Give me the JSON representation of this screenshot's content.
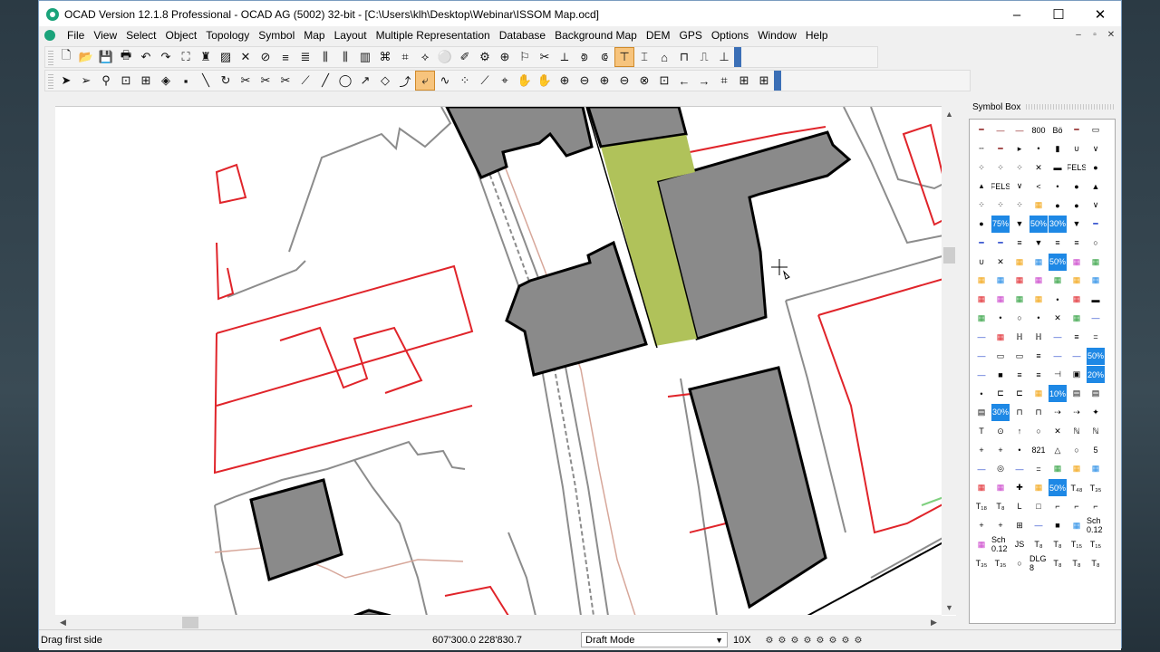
{
  "window": {
    "title": "OCAD Version 12.1.8  Professional - OCAD AG (5002) 32-bit - [C:\\Users\\klh\\Desktop\\Webinar\\ISSOM Map.ocd]",
    "minimize": "–",
    "maximize": "☐",
    "close": "✕"
  },
  "menu": [
    "File",
    "View",
    "Select",
    "Object",
    "Topology",
    "Symbol",
    "Map",
    "Layout",
    "Multiple Representation",
    "Database",
    "Background Map",
    "DEM",
    "GPS",
    "Options",
    "Window",
    "Help"
  ],
  "mdi": [
    "–",
    "▫",
    "✕"
  ],
  "toolbar1": [
    "🗋",
    "📂",
    "💾",
    "🖶",
    "↶",
    "↷",
    "⛶",
    "♜",
    "▨",
    "✕",
    "⊘",
    "≡",
    "≣",
    "⫼",
    "⫼",
    "▥",
    "⌘",
    "⌗",
    "⟡",
    "⚪",
    "✐",
    "⚙",
    "⊕",
    "⚐",
    "✂",
    "⟂",
    "⟄",
    "⟃",
    "⊤",
    "⌶",
    "⌂",
    "⊓",
    "⎍",
    "⊥"
  ],
  "toolbar2": [
    "➤",
    "➢",
    "⚲",
    "⊡",
    "⊞",
    "◈",
    "▪",
    "╲",
    "↻",
    "✂",
    "✂",
    "✂",
    "⟋",
    "╱",
    "◯",
    "↗",
    "◇",
    "⤴",
    "⤶",
    "∿",
    "⁘",
    "⟋",
    "⌖",
    "✋",
    "✋",
    "⊕",
    "⊖",
    "⊕",
    "⊖",
    "⊗",
    "⊡",
    "←",
    "→",
    "⌗",
    "⊞",
    "⊞"
  ],
  "symbol_box": {
    "title": "Symbol Box",
    "symbols": [
      "━",
      "—",
      "—",
      "800",
      "Bö",
      "━",
      "▭",
      "╌",
      "━",
      "▸",
      "•",
      "▮",
      "∪",
      "∨",
      "⁘",
      "⁘",
      "⁘",
      "✕",
      "▬",
      "FELS",
      "●",
      "▴",
      "FELS",
      "∨",
      "<",
      "•",
      "●",
      "▲",
      "⁘",
      "⁘",
      "⁘",
      "▦",
      "●",
      "●",
      "∨",
      "●",
      "75%",
      "▼",
      "50%",
      "30%",
      "▼",
      "━",
      "━",
      "━",
      "≡",
      "▼",
      "≡",
      "≡",
      "○",
      "∪",
      "✕",
      "▦",
      "▦",
      "50%",
      "▦",
      "▦",
      "▦",
      "▦",
      "▦",
      "▦",
      "▦",
      "▦",
      "▦",
      "▦",
      "▦",
      "▦",
      "▦",
      "•",
      "▦",
      "▬",
      "▦",
      "•",
      "○",
      "•",
      "✕",
      "▦",
      "—",
      "—",
      "▦",
      "ℍ",
      "ℍ",
      "—",
      "≡",
      "=",
      "—",
      "▭",
      "▭",
      "≡",
      "—",
      "—",
      "50%",
      "—",
      "■",
      "≡",
      "≡",
      "⊣",
      "▣",
      "20%",
      "•",
      "⊏",
      "⊏",
      "▦",
      "10%",
      "▤",
      "▤",
      "▤",
      "30%",
      "⊓",
      "⊓",
      "⇢",
      "⇢",
      "✦",
      "T",
      "⊙",
      "↑",
      "○",
      "✕",
      "ℕ",
      "ℕ",
      "+",
      "+",
      "•",
      "821",
      "△",
      "○",
      "5",
      "—",
      "◎",
      "—",
      "=",
      "▦",
      "▦",
      "▦",
      "▦",
      "▦",
      "✚",
      "▦",
      "50%",
      "T₄₈",
      "T₃₅",
      "T₁₈",
      "T₈",
      "L",
      "□",
      "⌐",
      "⌐",
      "⌐",
      "+",
      "+",
      "⊞",
      "—",
      "■",
      "▦",
      "Sch 0.12",
      "▦",
      "Sch 0.12",
      "JS",
      "T₈",
      "T₈",
      "T₁₅",
      "T₁₅",
      "T₃₅",
      "T₃₅",
      "○",
      "DLG 8",
      "T₈",
      "T₈",
      "T₈",
      "",
      ""
    ]
  },
  "status": {
    "message": "Drag first side",
    "coordinates": "607'300.0  228'830.7",
    "mode": "Draft Mode",
    "zoom": "10X"
  },
  "colors": {
    "building": "#8a8a8a",
    "lawn": "#b0c25a",
    "red_line": "#e0242a",
    "grey_line": "#8c8c8c",
    "accent_button": "#f7c47d"
  }
}
